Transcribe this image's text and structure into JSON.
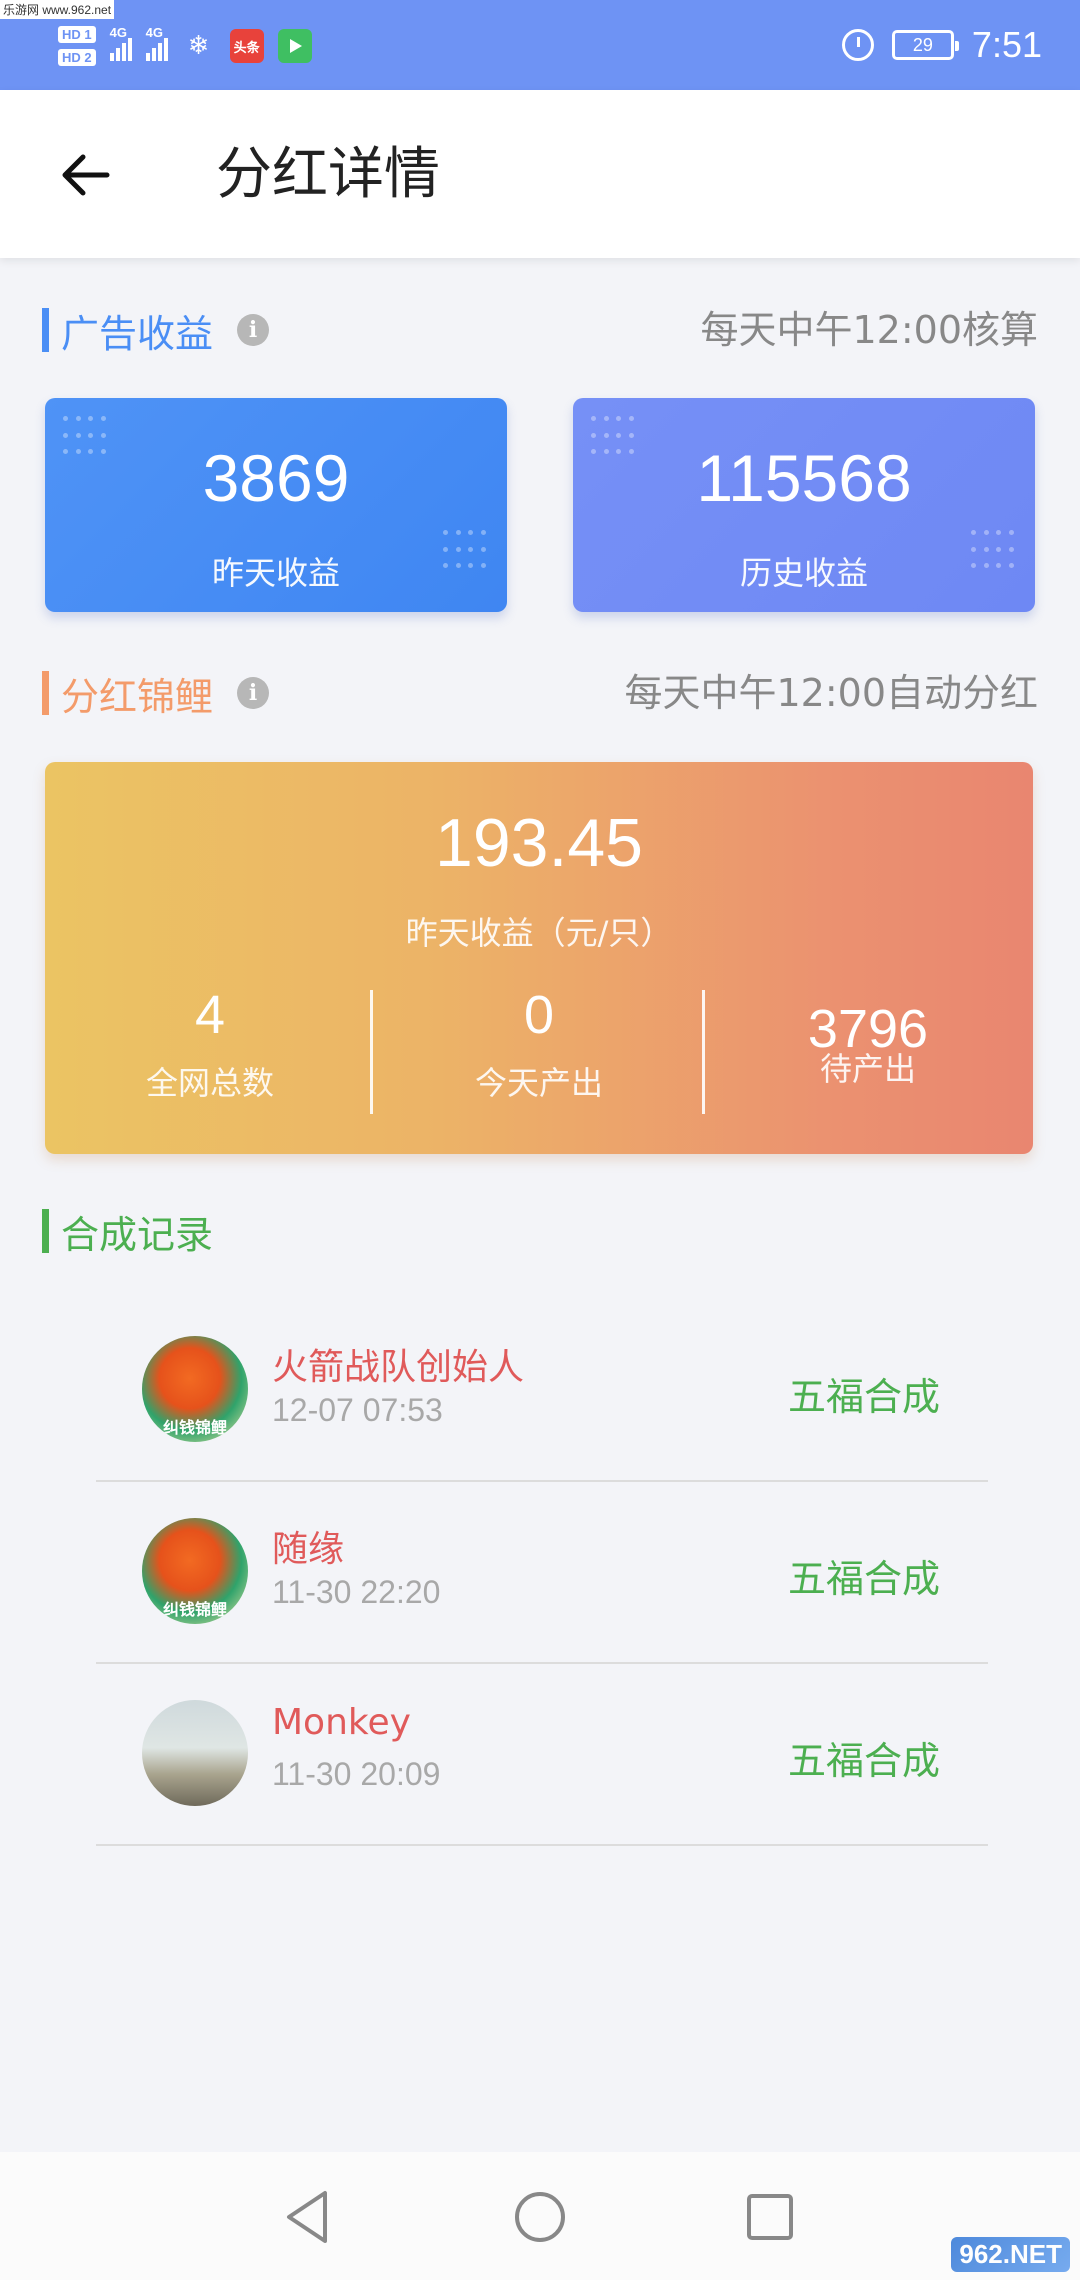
{
  "status_bar": {
    "watermark_site": "乐游网 www.962.net",
    "hd1": "HD 1",
    "hd2": "HD 2",
    "net1": "4G",
    "net2": "4G",
    "app_toutiao": "头条",
    "battery": "29",
    "time": "7:51"
  },
  "header": {
    "title": "分红详情"
  },
  "ad_section": {
    "title": "广告收益",
    "note": "每天中午12:00核算",
    "accent": "#4a8ef5",
    "cards": [
      {
        "value": "3869",
        "label": "昨天收益"
      },
      {
        "value": "115568",
        "label": "历史收益"
      }
    ]
  },
  "koi_section": {
    "title": "分红锦鲤",
    "note": "每天中午12:00自动分红",
    "accent": "#f39b6a",
    "main_value": "193.45",
    "main_label": "昨天收益（元/只）",
    "stats": [
      {
        "value": "4",
        "label": "全网总数"
      },
      {
        "value": "0",
        "label": "今天产出"
      },
      {
        "value": "3796",
        "label": "待产出"
      }
    ]
  },
  "records_section": {
    "title": "合成记录",
    "accent": "#4caf50",
    "items": [
      {
        "name": "火箭战队创始人",
        "time": "12-07 07:53",
        "action": "五福合成",
        "avatar_text": "纠钱锦鲤"
      },
      {
        "name": "随缘",
        "time": "11-30 22:20",
        "action": "五福合成",
        "avatar_text": "纠钱锦鲤"
      },
      {
        "name": "Monkey",
        "time": "11-30 20:09",
        "action": "五福合成",
        "avatar_text": ""
      }
    ]
  },
  "watermark": "962.NET"
}
